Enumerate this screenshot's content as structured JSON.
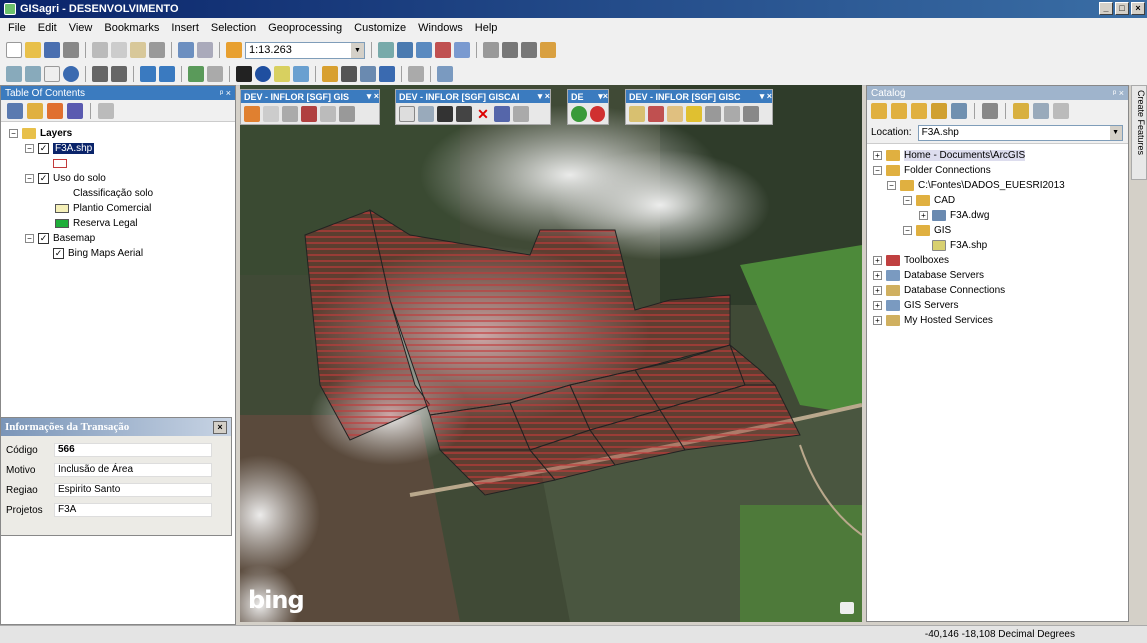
{
  "window": {
    "title": "GISagri - DESENVOLVIMENTO"
  },
  "menu": [
    "File",
    "Edit",
    "View",
    "Bookmarks",
    "Insert",
    "Selection",
    "Geoprocessing",
    "Customize",
    "Windows",
    "Help"
  ],
  "toolbar": {
    "scale": "1:13.263"
  },
  "toc": {
    "title": "Table Of Contents",
    "layers_label": "Layers",
    "f3a": "F3A.shp",
    "uso": "Uso do solo",
    "classificacao": "Classificação solo",
    "plantio": "Plantio Comercial",
    "reserva": "Reserva Legal",
    "basemap": "Basemap",
    "bing": "Bing Maps Aerial"
  },
  "colors": {
    "plantio": "#f5f0b8",
    "reserva": "#1fae3a",
    "f3a": "#c23a3a",
    "accent": "#3b7bbf"
  },
  "transacao": {
    "title": "Informações da Transação",
    "codigo_label": "Código",
    "codigo": "566",
    "motivo_label": "Motivo",
    "motivo": "Inclusão de Área",
    "regiao_label": "Regiao",
    "regiao": "Espirito Santo",
    "projetos_label": "Projetos",
    "projetos": "F3A"
  },
  "map_toolbars": [
    "DEV - INFLOR [SGF] GIS",
    "DEV - INFLOR [SGF] GISCAI",
    "DE",
    "DEV - INFLOR [SGF] GISC"
  ],
  "map": {
    "logo": "bing"
  },
  "catalog": {
    "title": "Catalog",
    "location_label": "Location:",
    "location_value": "F3A.shp",
    "home": "Home - Documents\\ArcGIS",
    "folder_connections": "Folder Connections",
    "fontes": "C:\\Fontes\\DADOS_EUESRI2013",
    "cad": "CAD",
    "f3a_dwg": "F3A.dwg",
    "gis": "GIS",
    "f3a_shp": "F3A.shp",
    "toolboxes": "Toolboxes",
    "db_servers": "Database Servers",
    "db_connections": "Database Connections",
    "gis_servers": "GIS Servers",
    "hosted": "My Hosted Services"
  },
  "side_tab": "Create Features",
  "status": {
    "coords": "-40,146  -18,108 Decimal Degrees"
  }
}
